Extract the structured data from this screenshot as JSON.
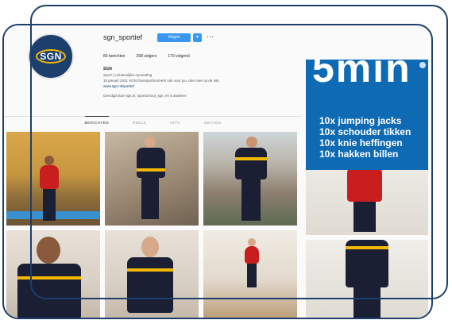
{
  "profile": {
    "username": "sgn_sportief",
    "follow_label": "Volgen",
    "chevron": "▾",
    "more": "···",
    "stats": [
      "80 berichten",
      "298 volgers",
      "170 volgend"
    ],
    "bio_name": "SGN",
    "bio_lines": [
      "Sport | Lichamelijke opvoeding",
      "15 januari 2021 SGN thuissportmoment ook voor jou, doe mee op de site",
      "www.sgn.nl/sportief"
    ],
    "followed_by": "Gevolgd door sgn.nl, sportschool_sgn, en 5 anderen"
  },
  "tabs": [
    "BERICHTEN",
    "REELS",
    "IGTV",
    "GETAGD"
  ],
  "workout": {
    "big_text": "5min",
    "exercises": [
      "10x jumping jacks",
      "10x schouder tikken",
      "10x knie heffingen",
      "10x hakken billen"
    ]
  },
  "colors": {
    "brand": "#1c3f6e",
    "accent": "#f2b705",
    "button": "#3897f0",
    "workout_bg": "#0f6ab4"
  },
  "icons": {
    "more": "more-options-icon",
    "chevron": "chevron-down-icon"
  }
}
